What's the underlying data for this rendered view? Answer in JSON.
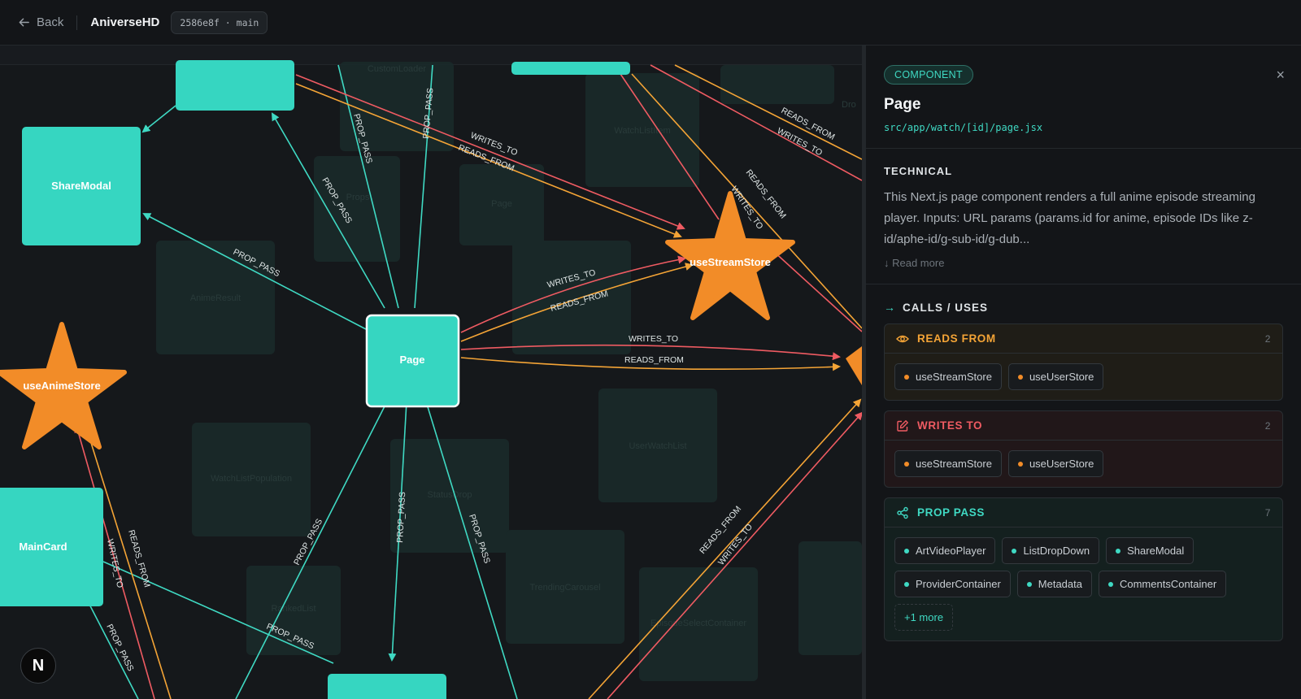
{
  "topbar": {
    "back_label": "Back",
    "app_title": "AniverseHD",
    "commit": "2586e8f · main"
  },
  "graph": {
    "nodes": {
      "page": "Page",
      "share_modal": "ShareModal",
      "main_card": "MainCard",
      "use_stream_store": "useStreamStore",
      "use_anime_store": "useAnimeStore"
    },
    "faded_nodes": [
      "CustomLoader",
      "WatchListItem",
      "Props",
      "Page",
      "AnimeResult",
      "WatchListPopulation",
      "StatusDrop",
      "TrendingCarousel",
      "UserWatchList",
      "EpisodeSelectContainer",
      "RankedList",
      "Dro"
    ],
    "edge_labels": {
      "writes_to": "WRITES_TO",
      "reads_from": "READS_FROM",
      "prop_pass": "PROP_PASS"
    }
  },
  "colors": {
    "accent": "#3fd9c3",
    "store": "#f28c28",
    "reads": "#f4a436",
    "writes": "#ef5b62"
  },
  "panel": {
    "badge": "COMPONENT",
    "close": "×",
    "title": "Page",
    "path": "src/app/watch/[id]/page.jsx",
    "technical_label": "TECHNICAL",
    "technical_text": "This Next.js page component renders a full anime episode streaming player. Inputs: URL params (params.id for anime, episode IDs like z-id/aphe-id/g-sub-id/g-dub...",
    "read_more": "↓ Read more",
    "calls_label": "CALLS / USES",
    "reads": {
      "label": "READS FROM",
      "count": "2",
      "items": [
        "useStreamStore",
        "useUserStore"
      ]
    },
    "writes": {
      "label": "WRITES TO",
      "count": "2",
      "items": [
        "useStreamStore",
        "useUserStore"
      ]
    },
    "prop": {
      "label": "PROP PASS",
      "count": "7",
      "items": [
        "ArtVideoPlayer",
        "ListDropDown",
        "ShareModal",
        "ProviderContainer",
        "Metadata",
        "CommentsContainer"
      ],
      "more": "+1 more"
    }
  },
  "badge_letter": "N"
}
